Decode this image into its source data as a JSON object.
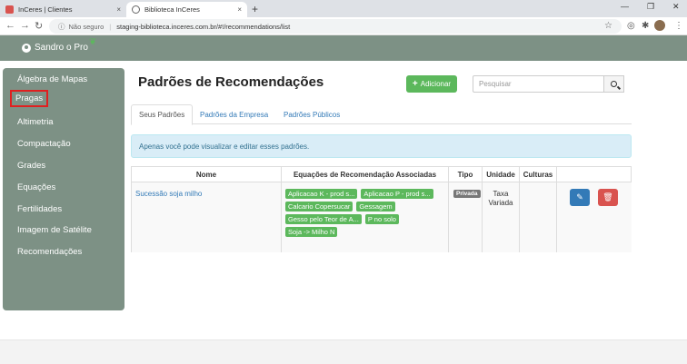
{
  "browser": {
    "tabs": [
      {
        "title": "InCeres | Clientes",
        "close": "×"
      },
      {
        "title": "Biblioteca InCeres",
        "close": "×"
      }
    ],
    "new_tab": "+",
    "window_controls": {
      "minimize": "—",
      "maximize": "❐",
      "close": "✕"
    },
    "nav": {
      "back": "←",
      "forward": "→",
      "reload": "↻"
    },
    "info_icon": "ⓘ",
    "security_text": "Não seguro",
    "separator": "|",
    "url": "staging-biblioteca.inceres.com.br/#!/recommendations/list",
    "star": "☆",
    "menu": "⋮"
  },
  "header": {
    "user_name": "Sandro o Pro",
    "leaf": "❦"
  },
  "sidebar": {
    "items": [
      {
        "label": "Álgebra de Mapas"
      },
      {
        "label": "Pragas"
      },
      {
        "label": "Altimetria"
      },
      {
        "label": "Compactação"
      },
      {
        "label": "Grades"
      },
      {
        "label": "Equações"
      },
      {
        "label": "Fertilidades"
      },
      {
        "label": "Imagem de Satélite"
      },
      {
        "label": "Recomendações"
      }
    ]
  },
  "main": {
    "title": "Padrões de Recomendações",
    "add_button": "Adicionar",
    "add_plus": "+",
    "search_placeholder": "Pesquisar",
    "tabs": [
      {
        "label": "Seus Padrões"
      },
      {
        "label": "Padrões da Empresa"
      },
      {
        "label": "Padrões Públicos"
      }
    ],
    "alert": "Apenas você pode visualizar e editar esses padrões.",
    "table": {
      "headers": [
        "Nome",
        "Equações de Recomendação Associadas",
        "Tipo",
        "Unidade",
        "Culturas",
        ""
      ],
      "rows": [
        {
          "nome": "Sucessão soja milho",
          "equacoes": [
            "Aplicacao K - prod s...",
            "Aplicacao P - prod s...",
            "Calcario Copersucar",
            "Gessagem",
            "Gesso pelo Teor de A...",
            "P no solo",
            "Soja -> Milho N"
          ],
          "tipo": "Privada",
          "unidade_1": "Taxa",
          "unidade_2": "Variada",
          "culturas": "",
          "edit_icon": "✎",
          "delete_icon": "🗑"
        }
      ]
    }
  },
  "colors": {
    "header_bg": "#7d9185",
    "success": "#5cb85c",
    "primary": "#337ab7",
    "danger": "#d9534f",
    "highlight_border": "#e02020"
  }
}
